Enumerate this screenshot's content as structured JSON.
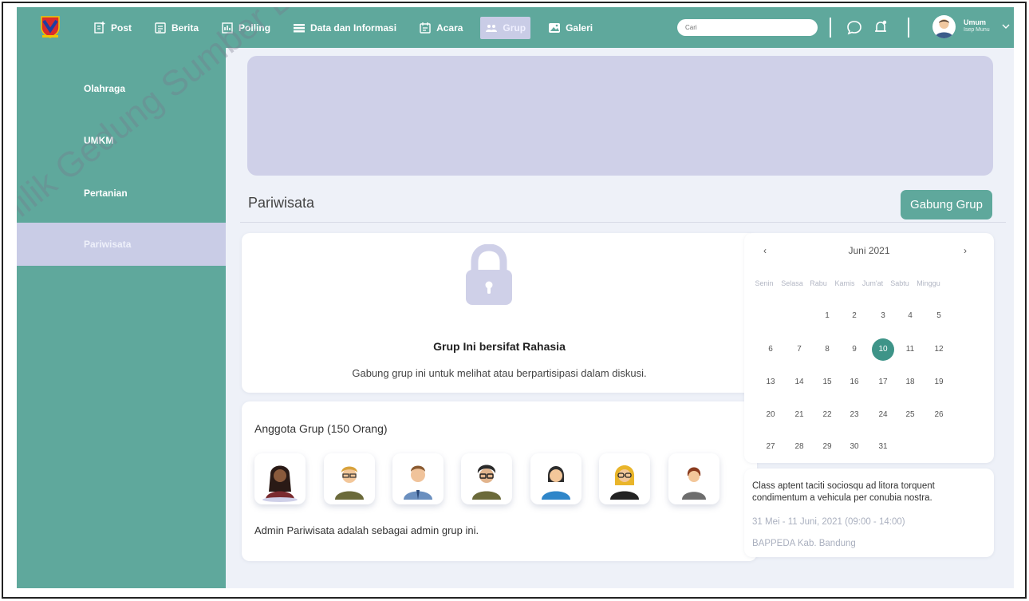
{
  "nav": {
    "items": [
      {
        "label": "Post",
        "icon": "post-icon"
      },
      {
        "label": "Berita",
        "icon": "news-icon"
      },
      {
        "label": "Polling",
        "icon": "poll-icon"
      },
      {
        "label": "Data dan Informasi",
        "icon": "data-icon"
      },
      {
        "label": "Acara",
        "icon": "event-icon"
      },
      {
        "label": "Grup",
        "icon": "group-icon",
        "active": true
      },
      {
        "label": "Galeri",
        "icon": "gallery-icon"
      }
    ],
    "search_placeholder": "Cari",
    "user": {
      "name": "Umum",
      "sub": "Isep Munu"
    }
  },
  "sidebar": {
    "items": [
      {
        "label": "Olahraga"
      },
      {
        "label": "UMKM"
      },
      {
        "label": "Pertanian"
      },
      {
        "label": "Pariwisata",
        "active": true
      }
    ]
  },
  "group": {
    "title": "Pariwisata",
    "join_label": "Gabung Grup",
    "secret_title": "Grup Ini bersifat Rahasia",
    "secret_desc": "Gabung grup ini untuk melihat atau berpartisipasi dalam diskusi.",
    "members_title": "Anggota Grup (150 Orang)",
    "members_note": "Admin Pariwisata adalah sebagai admin grup ini."
  },
  "calendar": {
    "prev": "‹",
    "next": "›",
    "month": "Juni 2021",
    "days": [
      "Senin",
      "Selasa",
      "Rabu",
      "Kamis",
      "Jum'at",
      "Sabtu",
      "Minggu"
    ],
    "weeks": [
      [
        "",
        "",
        "1",
        "2",
        "3",
        "4",
        "5"
      ],
      [
        "6",
        "7",
        "8",
        "9",
        "10",
        "11",
        "12"
      ],
      [
        "13",
        "14",
        "15",
        "16",
        "17",
        "18",
        "19"
      ],
      [
        "20",
        "21",
        "22",
        "23",
        "24",
        "25",
        "26"
      ],
      [
        "27",
        "28",
        "29",
        "30",
        "31",
        "",
        ""
      ]
    ],
    "today": "10"
  },
  "event": {
    "desc": "Class aptent taciti sociosqu ad litora torquent condimentum a vehicula per conubia nostra.",
    "date": "31 Mei - 11 Juni, 2021 (09:00 - 14:00)",
    "location": "BAPPEDA Kab. Bandung"
  },
  "watermark": "Milik Gedung Sumber Daya Alam",
  "colors": {
    "primary": "#5fa89c",
    "accent": "#c9cce6",
    "today": "#3e9488"
  }
}
